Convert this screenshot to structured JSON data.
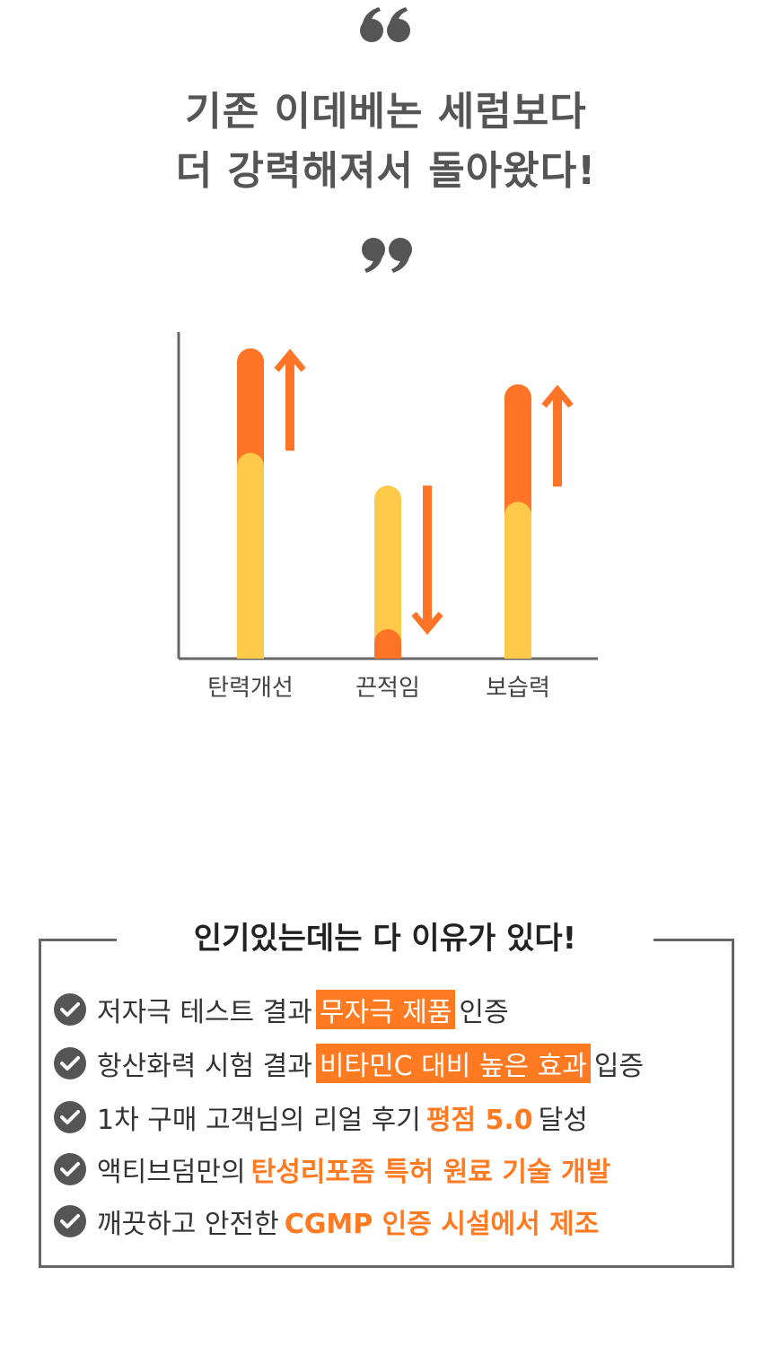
{
  "headline": {
    "line1": "기존 이데베논 세럼보다",
    "line2": "더 강력해져서 돌아왔다!"
  },
  "colors": {
    "orange": "#ff7426",
    "yellow": "#ffc94a",
    "axis": "#666666",
    "quote": "#555555"
  },
  "chart_data": {
    "type": "bar",
    "categories": [
      "탄력개선",
      "끈적임",
      "보습력"
    ],
    "series": [
      {
        "values": [
          63,
          53,
          48
        ]
      },
      {
        "values": [
          95,
          9,
          84
        ]
      }
    ],
    "directions": [
      "up",
      "down",
      "up"
    ],
    "ylim": [
      0,
      100
    ],
    "xlabel": "",
    "ylabel": ""
  },
  "reasons": {
    "title": "인기있는데는 다 이유가 있다!",
    "items": [
      {
        "pre": "저자극 테스트 결과",
        "highlight": "무자극 제품",
        "style": "box",
        "post": "인증"
      },
      {
        "pre": "항산화력 시험 결과",
        "highlight": "비타민C 대비 높은 효과",
        "style": "box",
        "post": "입증"
      },
      {
        "pre": "1차 구매 고객님의 리얼 후기",
        "highlight": "평점 5.0",
        "style": "text",
        "post": "달성"
      },
      {
        "pre": "액티브덤만의",
        "highlight": "탄성리포좀 특허 원료 기술 개발",
        "style": "text",
        "post": ""
      },
      {
        "pre": "깨끗하고 안전한",
        "highlight": "CGMP 인증 시설에서 제조",
        "style": "text",
        "post": ""
      }
    ]
  }
}
